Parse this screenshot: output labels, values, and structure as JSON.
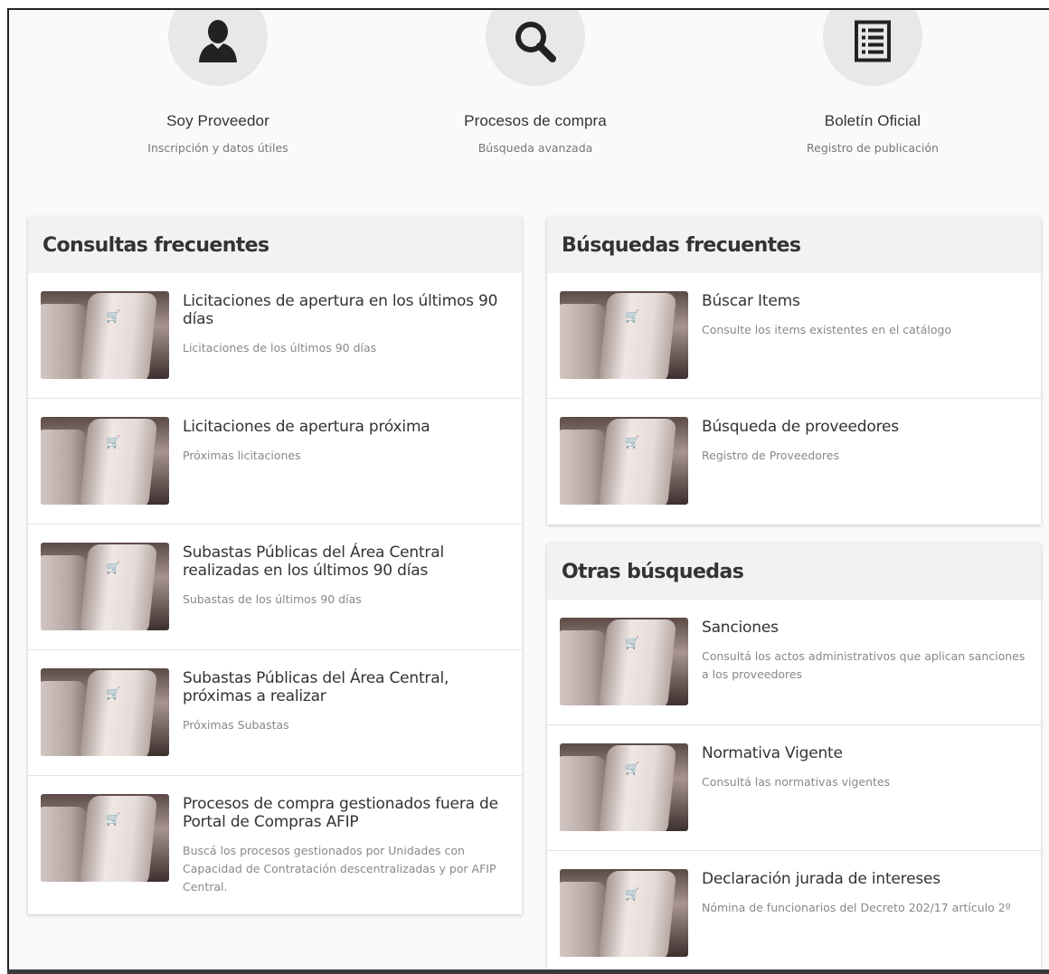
{
  "nav": [
    {
      "title": "Soy Proveedor",
      "subtitle": "Inscripción y datos útiles",
      "icon": "user-icon"
    },
    {
      "title": "Procesos de compra",
      "subtitle": "Búsqueda avanzada",
      "icon": "search-icon"
    },
    {
      "title": "Boletín Oficial",
      "subtitle": "Registro de publicación",
      "icon": "list-document-icon"
    }
  ],
  "consultas": {
    "heading": "Consultas frecuentes",
    "items": [
      {
        "title": "Licitaciones de apertura en los últimos 90 días",
        "subtitle": "Licitaciones de los últimos 90 días"
      },
      {
        "title": "Licitaciones de apertura próxima",
        "subtitle": "Próximas licitaciones"
      },
      {
        "title": "Subastas Públicas del Área Central realizadas en los últimos 90 días",
        "subtitle": "Subastas de los últimos 90 días"
      },
      {
        "title": "Subastas Públicas del Área Central, próximas a realizar",
        "subtitle": "Próximas Subastas"
      },
      {
        "title": "Procesos de compra gestionados fuera de Portal de Compras AFIP",
        "subtitle": "Buscá los procesos gestionados por Unidades con Capacidad de Contratación descentralizadas y por AFIP Central."
      }
    ]
  },
  "busquedas": {
    "heading": "Búsquedas frecuentes",
    "items": [
      {
        "title": "Búscar Items",
        "subtitle": "Consulte los items existentes en el catálogo"
      },
      {
        "title": "Búsqueda de proveedores",
        "subtitle": "Registro de Proveedores"
      }
    ]
  },
  "otras": {
    "heading": "Otras búsquedas",
    "items": [
      {
        "title": "Sanciones",
        "subtitle": "Consultá los actos administrativos que aplican sanciones a los proveedores"
      },
      {
        "title": "Normativa Vigente",
        "subtitle": "Consultá las normativas vigentes"
      },
      {
        "title": "Declaración jurada de intereses",
        "subtitle": "Nómina de funcionarios del Decreto 202/17 artículo 2º"
      }
    ]
  },
  "thumb_icon": "shopping-cart-icon"
}
